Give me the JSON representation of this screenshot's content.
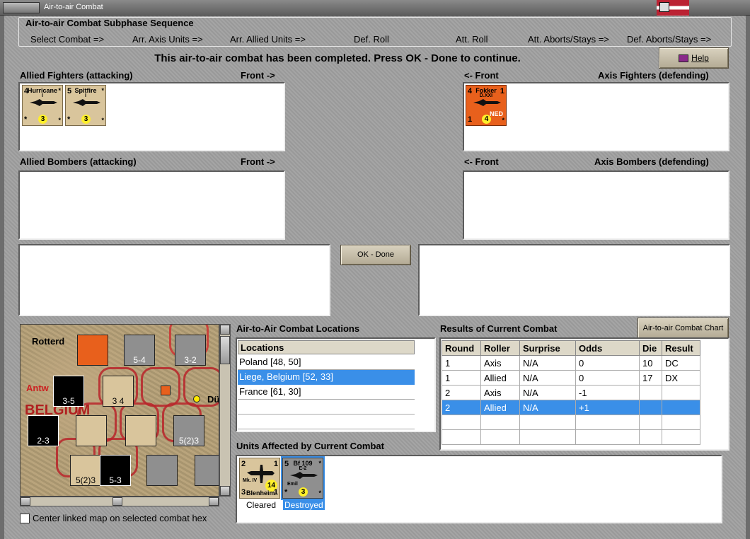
{
  "window": {
    "title": "Air-to-air Combat"
  },
  "sequence": {
    "title": "Air-to-air Combat Subphase Sequence",
    "steps": [
      "Select Combat =>",
      "Arr. Axis Units =>",
      "Arr. Allied Units =>",
      "Def. Roll",
      "Att. Roll",
      "Att. Aborts/Stays =>",
      "Def. Aborts/Stays =>"
    ]
  },
  "message": "This air-to-air combat has been completed.  Press OK - Done to continue.",
  "help_label": "Help",
  "zones": {
    "allied_fighters": "Allied Fighters (attacking)",
    "allied_fighters_front": "Front ->",
    "axis_fighters_front": "<- Front",
    "axis_fighters": "Axis Fighters (defending)",
    "allied_bombers": "Allied Bombers (attacking)",
    "allied_bombers_front": "Front ->",
    "axis_bombers_front": "<- Front",
    "axis_bombers": "Axis Bombers (defending)"
  },
  "counters": {
    "hurricane": {
      "name": "Hurricane",
      "sub": "I",
      "lt": "4",
      "rt": "*",
      "lb": "*",
      "rb": "*",
      "value": "3"
    },
    "spitfire": {
      "name": "Spitfire",
      "sub": "I",
      "lt": "5",
      "rt": "*",
      "lb": "*",
      "rb": "*",
      "value": "3"
    },
    "fokker": {
      "name": "Fokker",
      "sub": "D.XXI",
      "lt": "4",
      "rt": "1",
      "lb": "1",
      "rb": "*",
      "nat": "NED",
      "value": "4"
    },
    "blenheim": {
      "name": "Blenheim",
      "sub": "Mk. IV",
      "lt": "2",
      "rt": "1",
      "lb": "3",
      "rb": "1",
      "value": "14",
      "status": "Cleared"
    },
    "bf109": {
      "name": "Bf 109",
      "sub": "E-2",
      "lt": "5",
      "rt": "*",
      "lb": "*",
      "rb": "*",
      "value": "3",
      "extra": "Emil",
      "status": "Destroyed"
    }
  },
  "ok_done_label": "OK - Done",
  "locations": {
    "title": "Air-to-Air Combat Locations",
    "header": "Locations",
    "items": [
      "Poland [48, 50]",
      "Liege, Belgium [52, 33]",
      "France [61, 30]"
    ],
    "selected_index": 1
  },
  "results": {
    "title": "Results of Current Combat",
    "chart_button": "Air-to-air Combat Chart",
    "columns": [
      "Round",
      "Roller",
      "Surprise",
      "Odds",
      "Die",
      "Result"
    ],
    "rows": [
      [
        "1",
        "Axis",
        "N/A",
        "0",
        "10",
        "DC"
      ],
      [
        "1",
        "Allied",
        "N/A",
        "0",
        "17",
        "DX"
      ],
      [
        "2",
        "Axis",
        "N/A",
        "-1",
        "",
        ""
      ],
      [
        "2",
        "Allied",
        "N/A",
        "+1",
        "",
        ""
      ]
    ],
    "selected_row": 3
  },
  "affected": {
    "title": "Units Affected by Current Combat"
  },
  "map": {
    "labels": [
      "Rotterd",
      "Antw",
      "BELGIUM",
      "Dü"
    ],
    "units": [
      {
        "top": "5-4"
      },
      {
        "top": "3-2"
      },
      {
        "top": "3-5"
      },
      {
        "top": "3 4"
      },
      {
        "top": "2-3"
      },
      {
        "top": "5(2)3"
      },
      {
        "top": "5(2)3"
      },
      {
        "top": "5-3"
      }
    ]
  },
  "center_link_label": "Center linked map on selected combat hex",
  "colors": {
    "selection": "#3a8fe8",
    "counter_tan": "#d9c59c",
    "counter_orange": "#e8601c",
    "counter_grey": "#8f8f8f"
  }
}
